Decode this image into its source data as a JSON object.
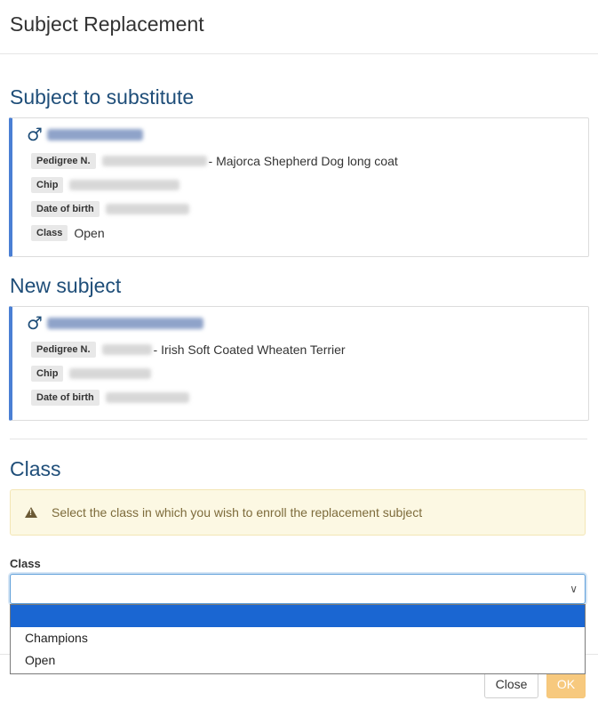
{
  "modal": {
    "title": "Subject Replacement"
  },
  "substitute": {
    "heading": "Subject to substitute",
    "gender_icon": "male-icon",
    "pedigree_label": "Pedigree N.",
    "pedigree_breed": "- Majorca Shepherd Dog long coat",
    "chip_label": "Chip",
    "dob_label": "Date of birth",
    "class_label": "Class",
    "class_value": "Open"
  },
  "new_subject": {
    "heading": "New subject",
    "gender_icon": "male-icon",
    "pedigree_label": "Pedigree N.",
    "pedigree_breed": "- Irish Soft Coated Wheaten Terrier",
    "chip_label": "Chip",
    "dob_label": "Date of birth"
  },
  "class_section": {
    "heading": "Class",
    "alert_icon": "warning-icon",
    "alert_text": "Select the class in which you wish to enroll the replacement subject",
    "field_label": "Class",
    "selected_value": "",
    "options": [
      "",
      "Champions",
      "Open"
    ]
  },
  "footer": {
    "close_label": "Close",
    "ok_label": "OK"
  },
  "colors": {
    "heading": "#1f4e79",
    "card_accent": "#4a7fd4",
    "alert_bg": "#fcf8e3",
    "option_highlight": "#1a66d2",
    "ok_button": "#f7c97e"
  }
}
